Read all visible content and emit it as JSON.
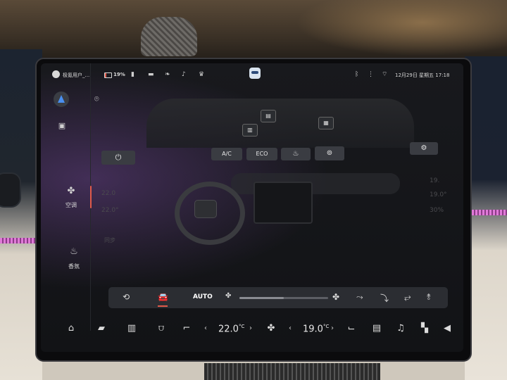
{
  "status_bar": {
    "user_name": "极氪用户_...",
    "battery": "19%",
    "datetime": "12月29日 星期五 17:18"
  },
  "rail": {
    "items": [
      {
        "label": "空调",
        "icon": "fan-icon",
        "active": true
      },
      {
        "label": "香氛",
        "icon": "fragrance-icon",
        "active": false
      }
    ]
  },
  "climate": {
    "power_icon": "⏻",
    "mode_buttons": [
      "A/C",
      "ECO"
    ],
    "settings_icon": "⚙",
    "fan": {
      "auto_label": "AUTO",
      "level": 0.5
    },
    "faded_labels": {
      "left_temp_top": "22.0",
      "left_temp": "22.0°",
      "sync": "同步",
      "right_top": "19.",
      "right_temp": "19.0°",
      "right_sub": "30%"
    }
  },
  "dock": {
    "driver_temp": "22.0",
    "passenger_temp": "19.0",
    "temp_unit": "°C"
  },
  "colors": {
    "accent": "#e05a4a",
    "screen_bg": "#121316",
    "panel": "#2b2d32"
  }
}
